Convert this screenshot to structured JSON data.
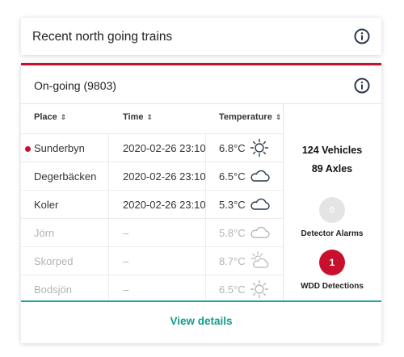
{
  "header": {
    "title": "Recent north going trains",
    "info_icon": "info-icon"
  },
  "panel": {
    "title": "On-going (9803)",
    "columns": {
      "place": "Place",
      "time": "Time",
      "temperature": "Temperature"
    },
    "rows": [
      {
        "place": "Sunderbyn",
        "time": "2020-02-26 23:10",
        "temp": "6.8°C",
        "weather": "sun-icon",
        "active": true,
        "dim": false
      },
      {
        "place": "Degerbäcken",
        "time": "2020-02-26 23:10",
        "temp": "6.5°C",
        "weather": "cloud-icon",
        "active": false,
        "dim": false
      },
      {
        "place": "Koler",
        "time": "2020-02-26 23:10",
        "temp": "5.3°C",
        "weather": "cloud-icon",
        "active": false,
        "dim": false
      },
      {
        "place": "Jörn",
        "time": "–",
        "temp": "5.8°C",
        "weather": "cloud-icon",
        "active": false,
        "dim": true
      },
      {
        "place": "Skorped",
        "time": "–",
        "temp": "8.7°C",
        "weather": "partly-cloudy-icon",
        "active": false,
        "dim": true
      },
      {
        "place": "Bodsjön",
        "time": "–",
        "temp": "6.5°C",
        "weather": "sun-icon",
        "active": false,
        "dim": true
      }
    ],
    "summary": {
      "vehicles": "124 Vehicles",
      "axles": "89 Axles",
      "detector_alarms_count": "0",
      "detector_alarms_label": "Detector Alarms",
      "wdd_count": "1",
      "wdd_label": "WDD Detections"
    },
    "view_details": "View details"
  },
  "colors": {
    "accent_red": "#c8102e",
    "teal": "#159c8f",
    "icon_navy": "#2c3a4e"
  }
}
